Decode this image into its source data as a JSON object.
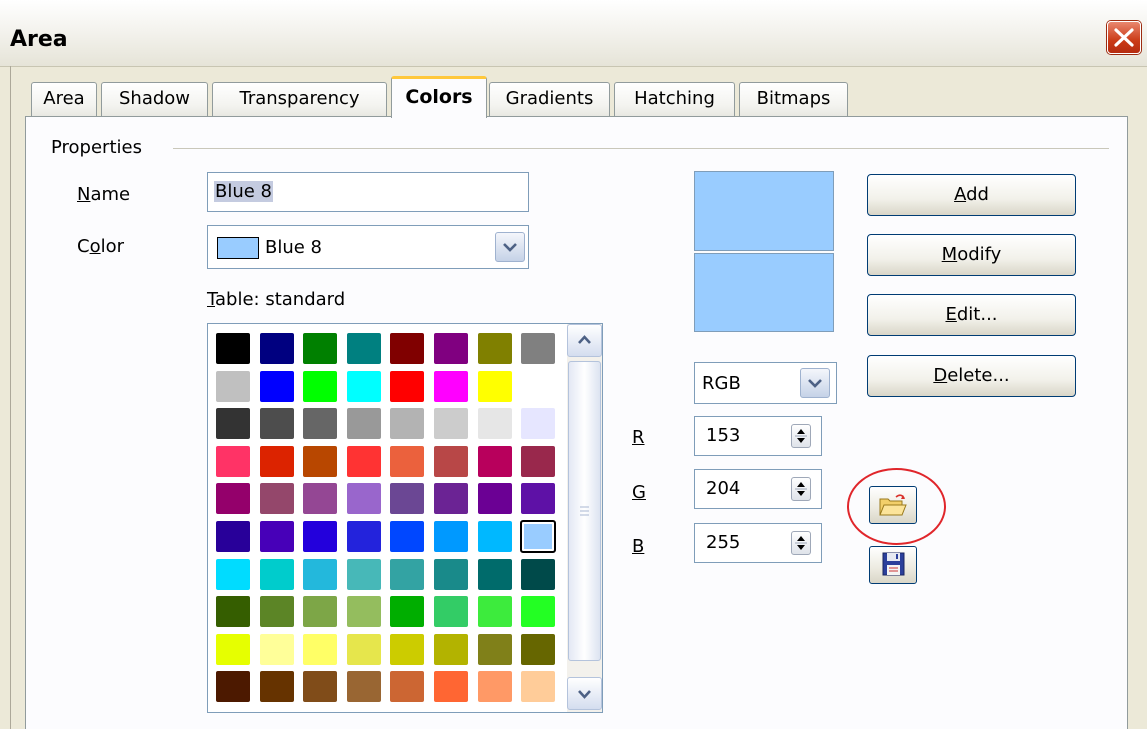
{
  "window": {
    "title": "Area"
  },
  "tabs": [
    "Area",
    "Shadow",
    "Transparency",
    "Colors",
    "Gradients",
    "Hatching",
    "Bitmaps"
  ],
  "active_tab": "Colors",
  "properties": {
    "group_label": "Properties",
    "name_label_prefix": "",
    "name_label_key": "N",
    "name_label_rest": "ame",
    "name_value": "Blue 8",
    "color_label_prefix": "C",
    "color_label_key": "o",
    "color_label_rest": "lor",
    "color_value": "Blue 8",
    "table_label_key": "T",
    "table_label_rest": "able: standard"
  },
  "buttons": {
    "add": {
      "key": "A",
      "rest": "dd"
    },
    "modify": {
      "key": "M",
      "rest": "odify"
    },
    "edit": {
      "key": "E",
      "rest": "dit..."
    },
    "delete": {
      "key": "D",
      "rest": "elete..."
    }
  },
  "color_model": {
    "selected": "RGB"
  },
  "rgb": {
    "r": {
      "label": "R",
      "value": "153"
    },
    "g": {
      "label": "G",
      "value": "204"
    },
    "b": {
      "label": "B",
      "value": "255"
    }
  },
  "colors": {
    "selected_color": "#99ccff",
    "palette": [
      [
        "#000000",
        "#000080",
        "#008000",
        "#008080",
        "#800000",
        "#800080",
        "#808000",
        "#808080"
      ],
      [
        "#c0c0c0",
        "#0000ff",
        "#00ff00",
        "#00ffff",
        "#ff0000",
        "#ff00ff",
        "#ffff00",
        "#ffffff"
      ],
      [
        "#333333",
        "#4d4d4d",
        "#666666",
        "#999999",
        "#b3b3b3",
        "#cccccc",
        "#e6e6e6",
        "#e6e6ff"
      ],
      [
        "#ff3366",
        "#dc2300",
        "#b84700",
        "#ff3333",
        "#eb613d",
        "#b84747",
        "#b8005c",
        "#99284c"
      ],
      [
        "#94006b",
        "#94476b",
        "#944794",
        "#9966cc",
        "#6b4794",
        "#6b2394",
        "#6b0094",
        "#5e11a6"
      ],
      [
        "#280099",
        "#4700b8",
        "#2300dc",
        "#2323dc",
        "#0047ff",
        "#0099ff",
        "#00b8ff",
        "#99ccff"
      ],
      [
        "#00dcff",
        "#00cccc",
        "#23b8dc",
        "#47b8b8",
        "#33a3a3",
        "#198a8a",
        "#006b6b",
        "#004a4a"
      ],
      [
        "#355e00",
        "#5c8526",
        "#7da647",
        "#94bd5e",
        "#00ae00",
        "#33cc66",
        "#3deb3d",
        "#23ff23"
      ],
      [
        "#e6ff00",
        "#ffff99",
        "#ffff66",
        "#e6e64c",
        "#cccc00",
        "#b3b300",
        "#808019",
        "#666600"
      ],
      [
        "#4c1900",
        "#663300",
        "#804c19",
        "#996633",
        "#cc6633",
        "#ff6633",
        "#ff9966",
        "#ffcc99"
      ]
    ],
    "selected_index": [
      5,
      7
    ]
  },
  "icons": {
    "close": "close-icon",
    "load": "open-folder-icon",
    "save": "floppy-disk-icon",
    "scroll_up": "chevron-up-icon",
    "scroll_down": "chevron-down-icon",
    "dropdown": "chevron-down-icon",
    "spinner": "spinner-arrows-icon"
  }
}
